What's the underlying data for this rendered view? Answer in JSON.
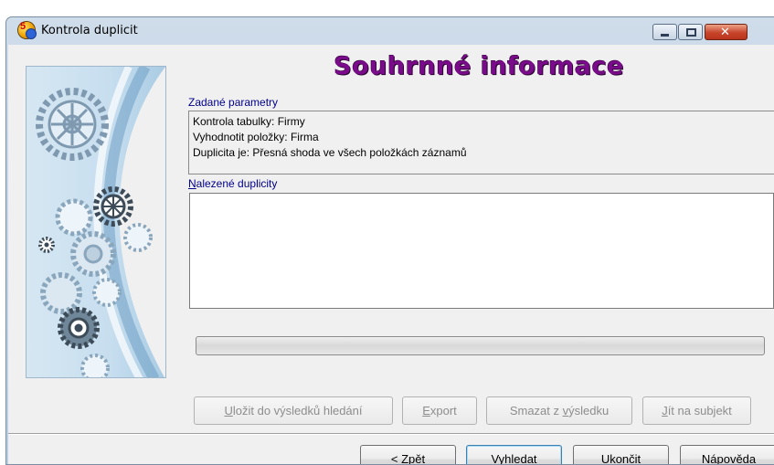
{
  "window": {
    "title": "Kontrola duplicit",
    "icon": "app-logo-icon",
    "controls": [
      "minimize-icon",
      "maximize-icon",
      "close-icon"
    ]
  },
  "main": {
    "heading": "Souhrnné informace",
    "params_label": "Zadané parametry",
    "params": [
      "Kontrola tabulky: Firmy",
      "Vyhodnotit položky: Firma",
      "Duplicita je: Přesná shoda ve všech položkách záznamů"
    ],
    "duplicates_label_accel": "N",
    "duplicates_label_rest": "alezené duplicity",
    "duplicates": [],
    "progress": 0
  },
  "actions": {
    "save": {
      "pre": "",
      "accel": "U",
      "post": "ložit do výsledků hledání"
    },
    "export": {
      "pre": "",
      "accel": "E",
      "post": "xport"
    },
    "remove": {
      "pre": "Smazat z ",
      "accel": "v",
      "post": "ýsledku"
    },
    "goto": {
      "pre": "",
      "accel": "J",
      "post": "ít na subjekt"
    }
  },
  "footer": {
    "back": {
      "pre": "< ",
      "accel": "Z",
      "post": "pět"
    },
    "search": "Vyhledat",
    "end": {
      "pre": "U",
      "accel": "k",
      "post": "ončit"
    },
    "help": {
      "pre": "",
      "accel": "N",
      "post": "ápověda"
    }
  },
  "colors": {
    "heading": "#7a0b8a",
    "label": "#00008b",
    "gears": "#7f9ab0"
  },
  "decor": {
    "image": "gears-illustration"
  }
}
